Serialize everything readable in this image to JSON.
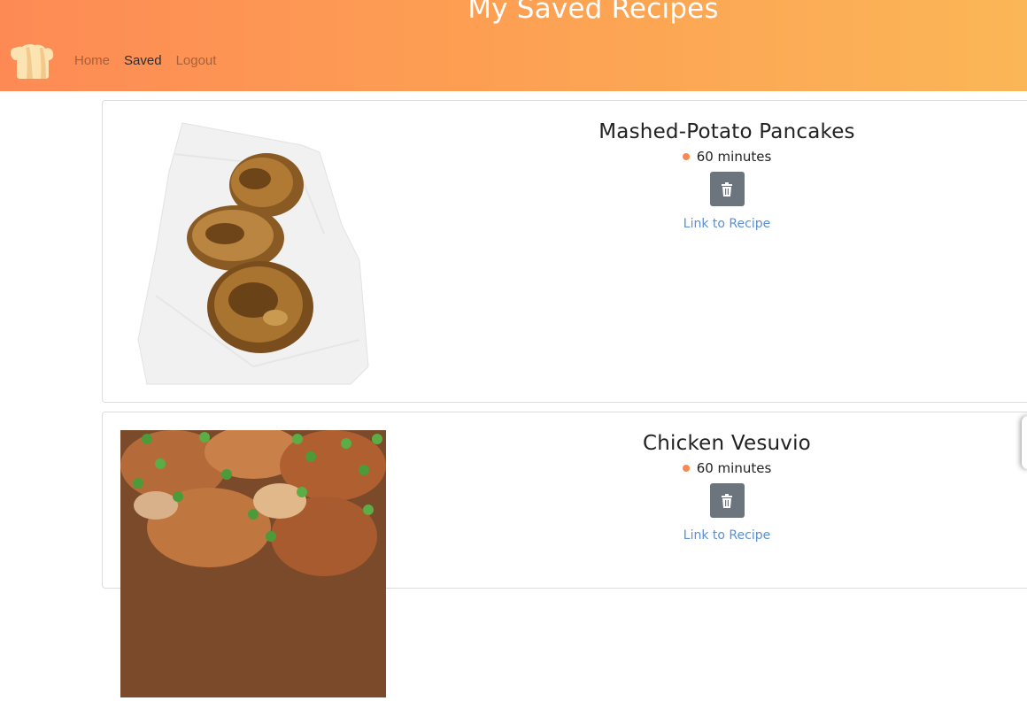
{
  "header": {
    "title": "My Saved Recipes",
    "logo": "chef-hat-icon"
  },
  "nav": {
    "items": [
      {
        "label": "Home",
        "active": false
      },
      {
        "label": "Saved",
        "active": true
      },
      {
        "label": "Logout",
        "active": false
      }
    ]
  },
  "recipes": [
    {
      "title": "Mashed-Potato Pancakes",
      "time": "60 minutes",
      "image": "potato-pancakes-photo",
      "delete_icon": "trash-icon",
      "link_label": "Link to Recipe"
    },
    {
      "title": "Chicken Vesuvio",
      "time": "60 minutes",
      "image": "chicken-vesuvio-photo",
      "delete_icon": "trash-icon",
      "link_label": "Link to Recipe"
    }
  ],
  "colors": {
    "header_start": "#fd8a55",
    "header_end": "#fbb657",
    "time_dot": "#f78a4e",
    "delete_button": "#6c757d",
    "link": "#5b8ed6"
  }
}
